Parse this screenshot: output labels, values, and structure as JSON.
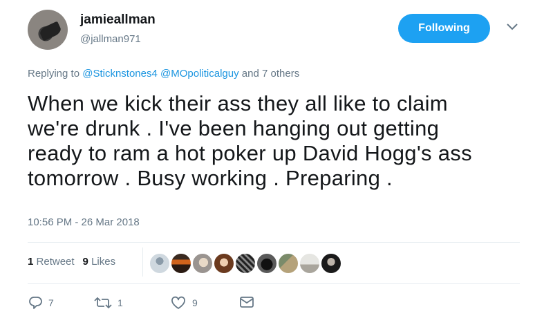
{
  "author": {
    "display_name": "jamieallman",
    "handle": "@jallman971"
  },
  "follow_button": {
    "label": "Following",
    "color": "#1da1f2"
  },
  "replying": {
    "prefix": "Replying to",
    "mention_1": "@Sticknstones4",
    "mention_2": "@MOpoliticalguy",
    "suffix": "and 7 others"
  },
  "tweet": {
    "text": "When we kick their ass they all like to claim\nwe're drunk . I've been hanging out getting\nready to ram a hot poker up David Hogg's ass\ntomorrow . Busy working . Preparing .",
    "timestamp": "10:56 PM - 26 Mar 2018"
  },
  "stats": {
    "retweet_count": "1",
    "retweet_label": "Retweet",
    "like_count": "9",
    "like_label": "Likes"
  },
  "actions": {
    "reply_count": "7",
    "retweet_count": "1",
    "like_count": "9"
  },
  "icons": {
    "caret": "chevron-down-icon",
    "reply": "reply-icon",
    "retweet": "retweet-icon",
    "like": "heart-icon",
    "dm": "envelope-icon"
  },
  "colors": {
    "link": "#1b95e0",
    "muted": "#657786",
    "text": "#14171a"
  }
}
